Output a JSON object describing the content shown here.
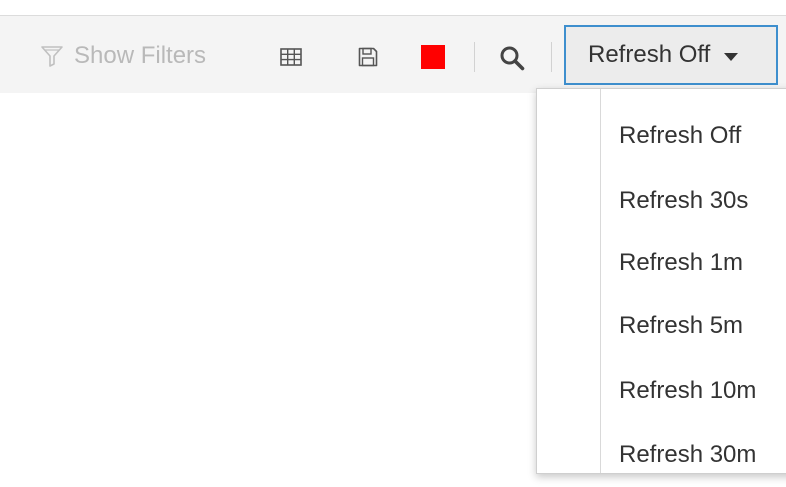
{
  "toolbar": {
    "show_filters_label": "Show Filters",
    "icons": [
      "filter-icon",
      "table-icon",
      "save-icon",
      "stop-icon",
      "search-icon"
    ],
    "stop_color": "#ff0000",
    "refresh_button_label": "Refresh Off"
  },
  "refresh_menu": {
    "items": [
      {
        "label": "Refresh Off"
      },
      {
        "label": "Refresh 30s"
      },
      {
        "label": "Refresh 1m"
      },
      {
        "label": "Refresh 5m"
      },
      {
        "label": "Refresh 10m"
      },
      {
        "label": "Refresh 30m"
      }
    ]
  },
  "colors": {
    "accent": "#3e8fce",
    "toolbar_bg": "#f4f4f4",
    "disabled_text": "#b9b9b9",
    "text": "#333333"
  }
}
